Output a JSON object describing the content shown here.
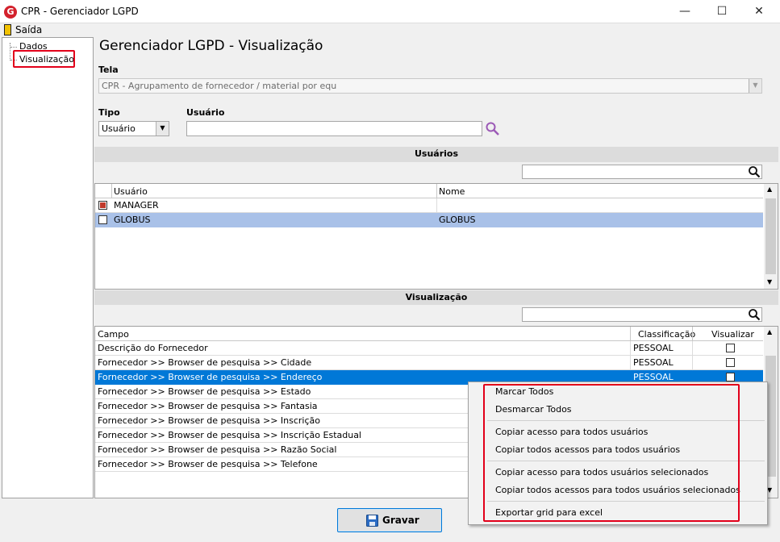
{
  "window": {
    "app_icon_letter": "G",
    "title": "CPR - Gerenciador LGPD",
    "minimize": "—",
    "maximize": "☐",
    "close": "✕"
  },
  "menu": {
    "exit_label": "Saída"
  },
  "sidebar": {
    "items": [
      {
        "label": "Dados"
      },
      {
        "label": "Visualização"
      }
    ]
  },
  "main": {
    "heading": "Gerenciador LGPD - Visualização",
    "tela_label": "Tela",
    "tela_value": "CPR - Agrupamento de fornecedor / material por equ",
    "tipo_label": "Tipo",
    "tipo_value": "Usuário",
    "usuario_label": "Usuário",
    "usuario_value": ""
  },
  "users_section": {
    "title": "Usuários",
    "search_value": "",
    "columns": [
      "Usuário",
      "Nome"
    ],
    "rows": [
      {
        "checked": true,
        "usuario": "MANAGER",
        "nome": ""
      },
      {
        "checked": false,
        "usuario": "GLOBUS",
        "nome": "GLOBUS"
      }
    ]
  },
  "view_section": {
    "title": "Visualização",
    "search_value": "",
    "columns": [
      "Campo",
      "Classificação",
      "Visualizar"
    ],
    "rows": [
      {
        "campo": "Descrição do Fornecedor",
        "classificacao": "PESSOAL"
      },
      {
        "campo": "Fornecedor >> Browser de pesquisa >> Cidade",
        "classificacao": "PESSOAL"
      },
      {
        "campo": "Fornecedor >> Browser de pesquisa >> Endereço",
        "classificacao": "PESSOAL"
      },
      {
        "campo": "Fornecedor >> Browser de pesquisa >> Estado",
        "classificacao": ""
      },
      {
        "campo": "Fornecedor >> Browser de pesquisa >> Fantasia",
        "classificacao": ""
      },
      {
        "campo": "Fornecedor >> Browser de pesquisa >> Inscrição",
        "classificacao": ""
      },
      {
        "campo": "Fornecedor >> Browser de pesquisa >> Inscrição Estadual",
        "classificacao": ""
      },
      {
        "campo": "Fornecedor >> Browser de pesquisa >> Razão Social",
        "classificacao": ""
      },
      {
        "campo": "Fornecedor >> Browser de pesquisa >> Telefone",
        "classificacao": ""
      }
    ]
  },
  "save_button": {
    "label": "Gravar"
  },
  "context_menu": {
    "items": [
      "Marcar Todos",
      "Desmarcar Todos",
      "Copiar acesso para todos usuários",
      "Copiar todos acessos para todos usuários",
      "Copiar acesso para todos usuários selecionados",
      "Copiar todos acessos para todos usuários selecionados",
      "Exportar grid para excel"
    ]
  },
  "colors": {
    "selection": "#0078d7",
    "highlight_border": "#e2001a",
    "light_selection": "#a9c1e8",
    "search_icon_purple": "#9b59b6"
  }
}
